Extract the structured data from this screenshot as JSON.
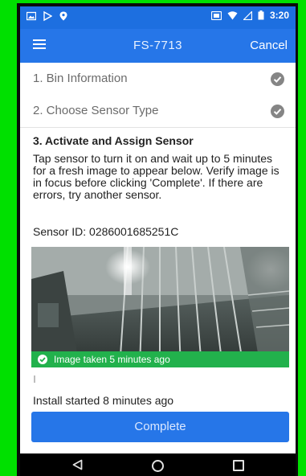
{
  "status_bar": {
    "time": "3:20",
    "left_icons": [
      "image-icon",
      "play-store-icon",
      "location-icon"
    ],
    "right_icons": [
      "sim-icon",
      "wifi-icon",
      "signal-icon",
      "battery-icon"
    ]
  },
  "app_bar": {
    "menu_icon": "menu-icon",
    "title": "FS-7713",
    "cancel_label": "Cancel"
  },
  "steps": [
    {
      "label": "1. Bin Information",
      "status_icon": "check-circle-icon",
      "status": "complete"
    },
    {
      "label": "2. Choose Sensor Type",
      "status_icon": "check-circle-icon",
      "status": "complete"
    }
  ],
  "active_step": {
    "title": "3. Activate and Assign Sensor",
    "instructions": "Tap sensor to turn it on and wait up to 5 minutes for a fresh image to appear below. Verify image is in focus before clicking 'Complete'. If there are errors, try another sensor.",
    "sensor_id": "Sensor ID: 0286001685251C",
    "image_status": "Image taken 5 minutes ago",
    "install_status": "Install started 8 minutes ago",
    "complete_label": "Complete"
  },
  "colors": {
    "primary": "#2676e8",
    "status_bar": "#1d6fe0",
    "success": "#22b14c",
    "frame_border": "#00e000"
  },
  "nav_bar": {
    "icons": [
      "back-icon",
      "home-icon",
      "recents-icon"
    ]
  }
}
